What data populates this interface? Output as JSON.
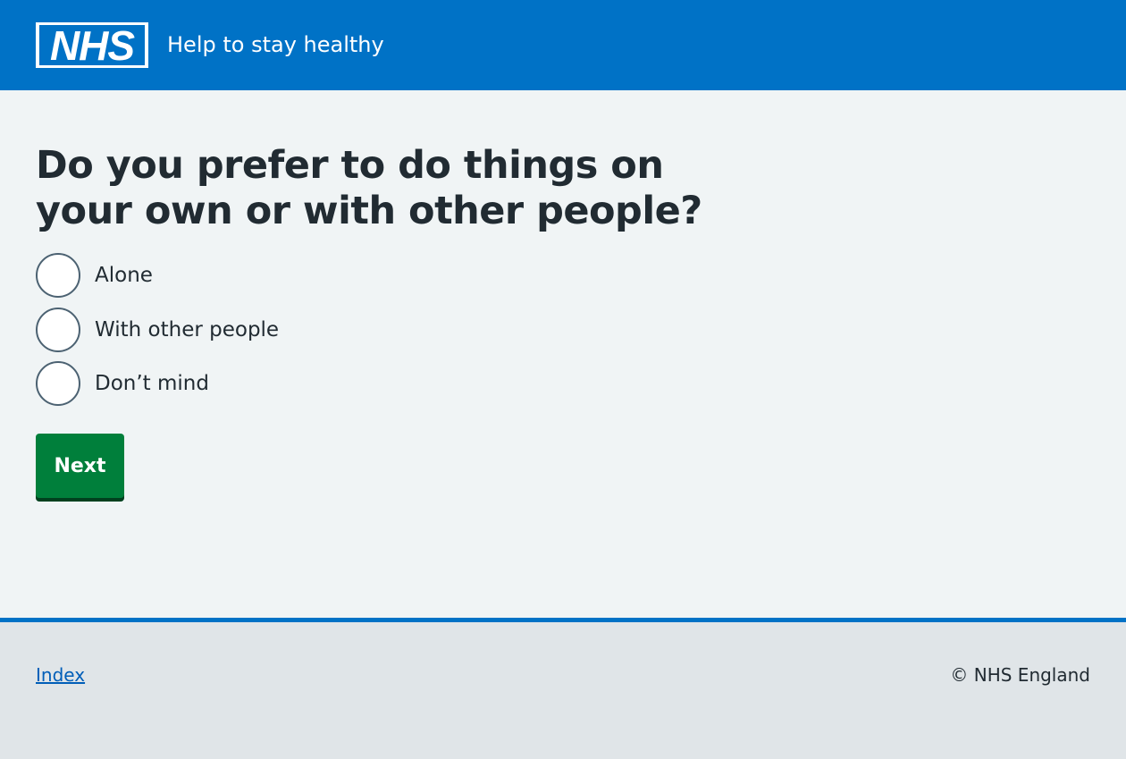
{
  "header": {
    "logo_text": "NHS",
    "service_name": "Help to stay healthy"
  },
  "main": {
    "question": "Do you prefer to do things on your own or with other people?",
    "options": [
      {
        "label": "Alone",
        "selected": false
      },
      {
        "label": "With other people",
        "selected": false
      },
      {
        "label": "Don’t mind",
        "selected": false
      }
    ],
    "next_label": "Next"
  },
  "footer": {
    "index_link": "Index",
    "copyright": "© NHS England"
  },
  "colors": {
    "header_blue": "#0072c6",
    "button_green": "#007f3b",
    "link_blue": "#005eb8",
    "page_bg": "#f0f4f5",
    "footer_bg": "#e0e5e8"
  }
}
